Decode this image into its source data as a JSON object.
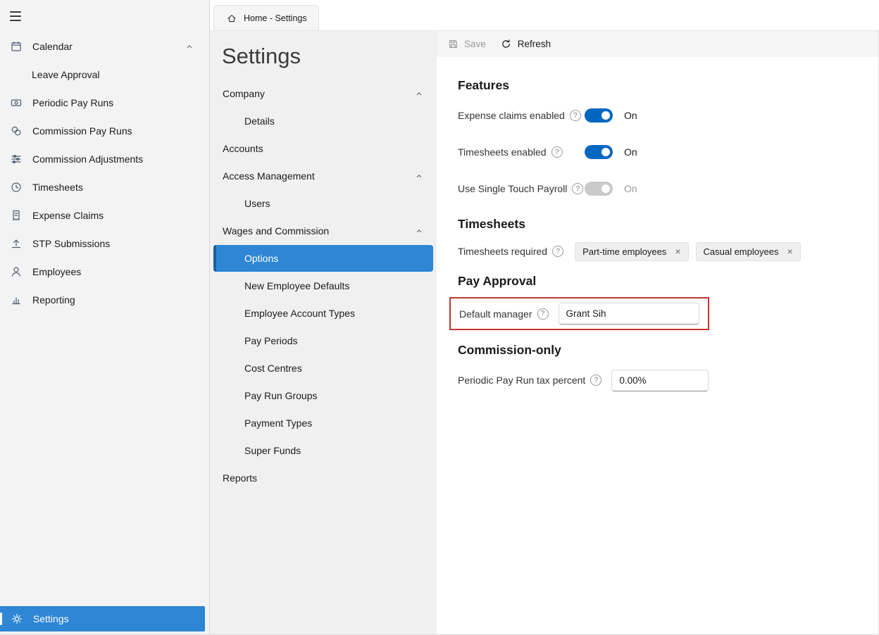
{
  "icons": {
    "close_glyph": "×",
    "help_glyph": "?"
  },
  "colors": {
    "accent": "#2e86d4",
    "accent_dark": "#1d5f9e",
    "toggle_on": "#0067c0",
    "annotation_red": "#c5362c"
  },
  "sidebar": {
    "items": [
      {
        "label": "Calendar"
      },
      {
        "label": "Leave Approval"
      },
      {
        "label": "Periodic Pay Runs"
      },
      {
        "label": "Commission Pay Runs"
      },
      {
        "label": "Commission Adjustments"
      },
      {
        "label": "Timesheets"
      },
      {
        "label": "Expense Claims"
      },
      {
        "label": "STP Submissions"
      },
      {
        "label": "Employees"
      },
      {
        "label": "Reporting"
      }
    ],
    "settings_label": "Settings"
  },
  "tab": {
    "label": "Home - Settings"
  },
  "settings_nav": {
    "title": "Settings",
    "company": "Company",
    "details": "Details",
    "accounts": "Accounts",
    "access_management": "Access Management",
    "users": "Users",
    "wages_and_commission": "Wages and Commission",
    "options": "Options",
    "new_employee_defaults": "New Employee Defaults",
    "employee_account_types": "Employee Account Types",
    "pay_periods": "Pay Periods",
    "cost_centres": "Cost Centres",
    "pay_run_groups": "Pay Run Groups",
    "payment_types": "Payment Types",
    "super_funds": "Super Funds",
    "reports": "Reports"
  },
  "toolbar": {
    "save": "Save",
    "refresh": "Refresh"
  },
  "features": {
    "heading": "Features",
    "rows": [
      {
        "label": "Expense claims enabled",
        "state": "On"
      },
      {
        "label": "Timesheets enabled",
        "state": "On"
      },
      {
        "label": "Use Single Touch Payroll",
        "state": "On"
      }
    ]
  },
  "timesheets": {
    "heading": "Timesheets",
    "label": "Timesheets required",
    "tags": [
      "Part-time employees",
      "Casual employees"
    ]
  },
  "pay_approval": {
    "heading": "Pay Approval",
    "label": "Default manager",
    "value": "Grant Sih"
  },
  "commission_only": {
    "heading": "Commission-only",
    "label": "Periodic Pay Run tax percent",
    "value": "0.00%"
  }
}
